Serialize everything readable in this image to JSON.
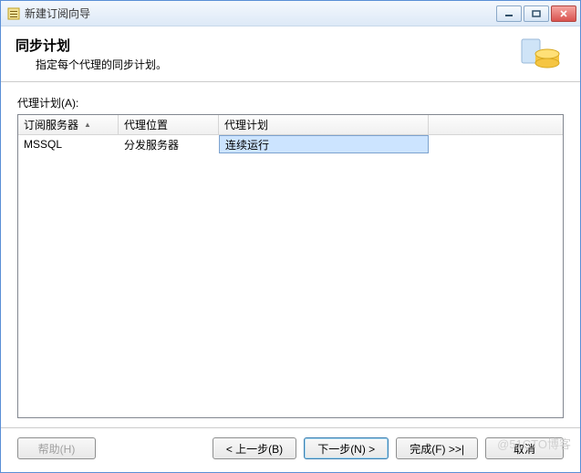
{
  "window": {
    "title": "新建订阅向导"
  },
  "header": {
    "title": "同步计划",
    "subtitle": "指定每个代理的同步计划。"
  },
  "section": {
    "label": "代理计划(A):"
  },
  "grid": {
    "columns": {
      "c1": "订阅服务器",
      "c2": "代理位置",
      "c3": "代理计划"
    },
    "row": {
      "server": "MSSQL",
      "location": "分发服务器",
      "schedule": "连续运行"
    }
  },
  "buttons": {
    "help": "帮助(H)",
    "back": "< 上一步(B)",
    "next": "下一步(N) >",
    "finish": "完成(F) >>|",
    "cancel": "取消"
  },
  "watermark": "@51CTO博客"
}
